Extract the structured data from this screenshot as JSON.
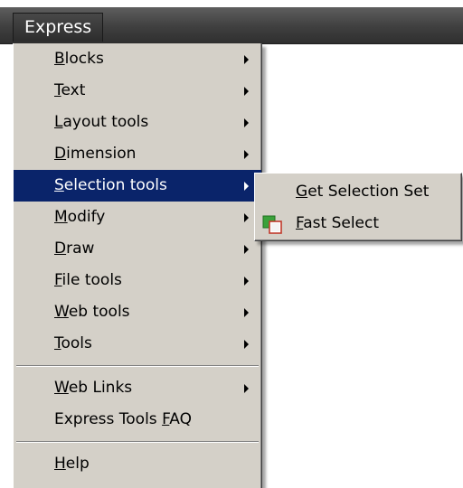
{
  "menubar": {
    "express_label": "Express"
  },
  "express_menu": {
    "items": [
      {
        "pre": "",
        "acc": "B",
        "post": "locks",
        "has_submenu": true
      },
      {
        "pre": "",
        "acc": "T",
        "post": "ext",
        "has_submenu": true
      },
      {
        "pre": "",
        "acc": "L",
        "post": "ayout tools",
        "has_submenu": true
      },
      {
        "pre": "",
        "acc": "D",
        "post": "imension",
        "has_submenu": true
      },
      {
        "pre": "",
        "acc": "S",
        "post": "election tools",
        "has_submenu": true,
        "selected": true
      },
      {
        "pre": "",
        "acc": "M",
        "post": "odify",
        "has_submenu": true
      },
      {
        "pre": "",
        "acc": "D",
        "post": "raw",
        "has_submenu": true
      },
      {
        "pre": "",
        "acc": "F",
        "post": "ile tools",
        "has_submenu": true
      },
      {
        "pre": "",
        "acc": "W",
        "post": "eb tools",
        "has_submenu": true
      },
      {
        "pre": "",
        "acc": "T",
        "post": "ools",
        "has_submenu": true
      }
    ],
    "group2": [
      {
        "pre": "",
        "acc": "W",
        "post": "eb Links",
        "has_submenu": true
      },
      {
        "pre": "Express Tools ",
        "acc": "F",
        "post": "AQ",
        "has_submenu": false
      }
    ],
    "group3": [
      {
        "pre": "",
        "acc": "H",
        "post": "elp",
        "has_submenu": false
      }
    ]
  },
  "selection_submenu": {
    "items": [
      {
        "pre": "",
        "acc": "G",
        "post": "et Selection Set",
        "icon": ""
      },
      {
        "pre": "",
        "acc": "F",
        "post": "ast Select",
        "icon": "fast-select-icon"
      }
    ]
  },
  "colors": {
    "menu_background": "#d4d0c8",
    "highlight": "#0a246a",
    "menubar": "#3f3f3f"
  }
}
